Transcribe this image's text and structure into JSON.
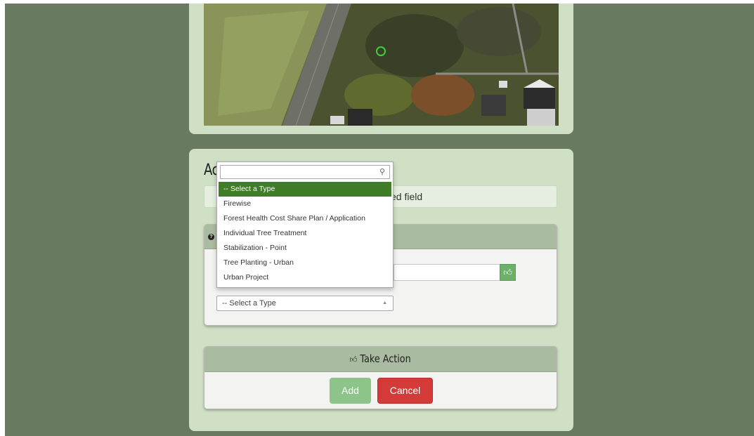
{
  "form": {
    "heading": "Ac",
    "required_note": "ed field"
  },
  "dropdown": {
    "search_value": "",
    "options": [
      "-- Select a Type",
      "Firewise",
      "Forest Health Cost Share Plan / Application",
      "Individual Tree Treatment",
      "Stabilization - Point",
      "Tree Planting - Urban",
      "Urban Project"
    ],
    "selected_index": 0
  },
  "type_select": {
    "value": "-- Select a Type"
  },
  "take_action": {
    "title": "Take Action",
    "add_label": "Add",
    "cancel_label": "Cancel"
  },
  "colors": {
    "page_background": "#687a60",
    "card_background": "#cfe0c5",
    "panel_header": "#a9bba0",
    "selected_option": "#3f7d26",
    "add_button": "#8cc48a",
    "cancel_button": "#d43b38"
  },
  "icons": [
    "map-location-marker",
    "help-icon",
    "search-icon",
    "thumbs-up-icon",
    "caret-up-icon"
  ]
}
